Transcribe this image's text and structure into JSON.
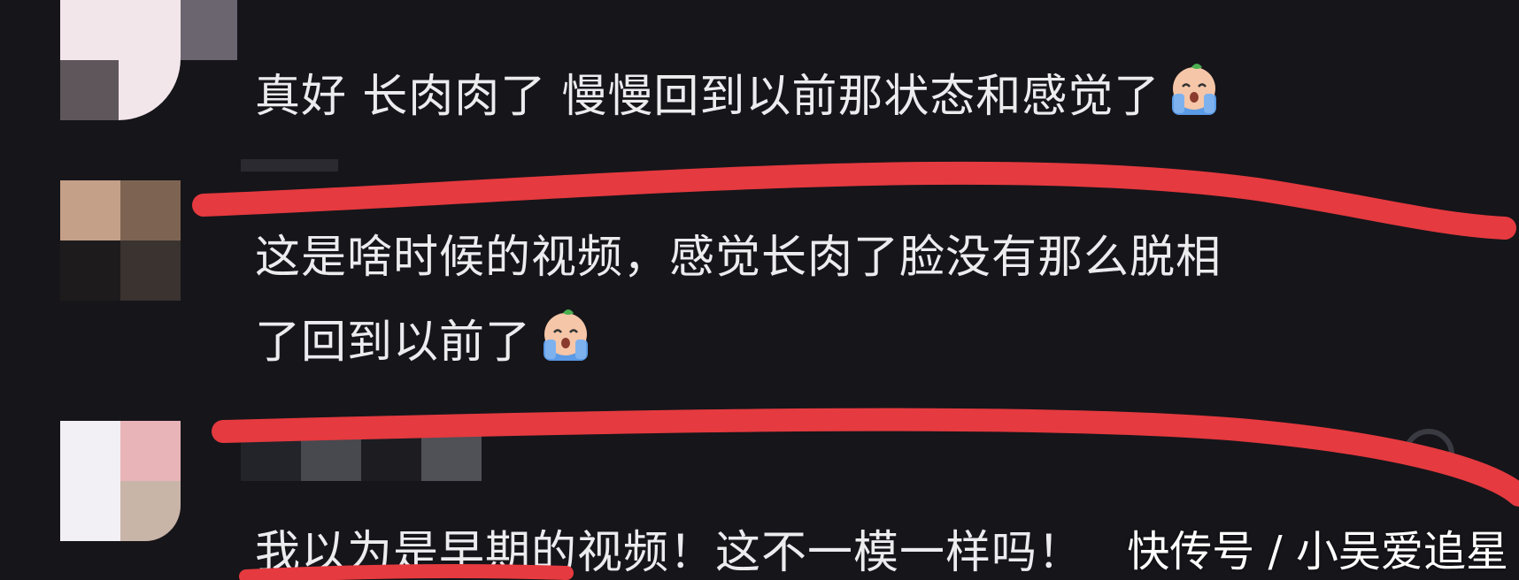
{
  "comments": [
    {
      "text": "真好 长肉肉了 慢慢回到以前那状态和感觉了",
      "emoji": "crying-face-emoji"
    },
    {
      "line1": "这是啥时候的视频，感觉长肉了脸没有那么脱相",
      "line2": "了回到以前了",
      "emoji": "crying-face-emoji"
    },
    {
      "text": "我以为是早期的视频！这不一模一样吗！"
    }
  ],
  "watermark": "快传号 / 小吴爱追星",
  "colors": {
    "background": "#16151a",
    "text": "#ececef",
    "highlight_stroke": "#e53a3f"
  }
}
